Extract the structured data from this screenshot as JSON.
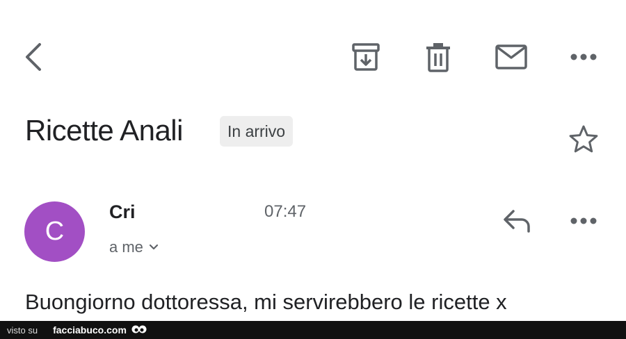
{
  "toolbar": {
    "back_icon": "arrow-left-icon",
    "archive_icon": "archive-icon",
    "delete_icon": "trash-icon",
    "mark_unread_icon": "envelope-icon",
    "more_icon": "more-horizontal-icon",
    "icon_color": "#5f6368"
  },
  "email": {
    "subject": "Ricette Anali",
    "label": "In arrivo",
    "star_icon": "star-outline-icon",
    "sender_initial": "C",
    "sender_name": "Cri",
    "time": "07:47",
    "recipient": "a me",
    "avatar_color": "#a24fc4",
    "body": "Buongiorno dottoressa, mi servirebbero le ricette x"
  },
  "footer": {
    "visto": "visto su",
    "site": "facciabuco.com"
  }
}
